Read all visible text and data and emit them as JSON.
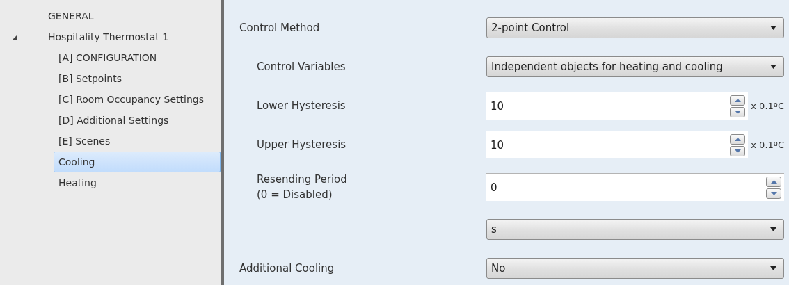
{
  "sidebar": {
    "items": [
      {
        "label": "GENERAL",
        "selected": false
      },
      {
        "label": "Hospitality Thermostat 1",
        "expanded": true,
        "selected": false,
        "children": [
          {
            "label": "[A] CONFIGURATION",
            "selected": false
          },
          {
            "label": "[B] Setpoints",
            "selected": false
          },
          {
            "label": "[C] Room Occupancy Settings",
            "selected": false
          },
          {
            "label": "[D] Additional Settings",
            "selected": false
          },
          {
            "label": "[E] Scenes",
            "selected": false
          },
          {
            "label": "Cooling",
            "selected": true
          },
          {
            "label": "Heating",
            "selected": false
          }
        ]
      }
    ]
  },
  "settings": [
    {
      "kind": "dropdown",
      "label": "Control Method",
      "value": "2-point Control",
      "children": [
        {
          "kind": "dropdown",
          "label": "Control Variables",
          "value": "Independent objects for heating and cooling"
        },
        {
          "kind": "spin",
          "label": "Lower Hysteresis",
          "value": "10",
          "unit": "x 0.1ºC"
        },
        {
          "kind": "spin",
          "label": "Upper Hysteresis",
          "value": "10",
          "unit": "x 0.1ºC"
        },
        {
          "kind": "spin",
          "label": "Resending Period",
          "note": "(0 = Disabled)",
          "value": "0"
        },
        {
          "kind": "dropdown",
          "value": "s"
        }
      ]
    },
    {
      "kind": "dropdown",
      "label": "Additional Cooling",
      "value": "No"
    }
  ]
}
